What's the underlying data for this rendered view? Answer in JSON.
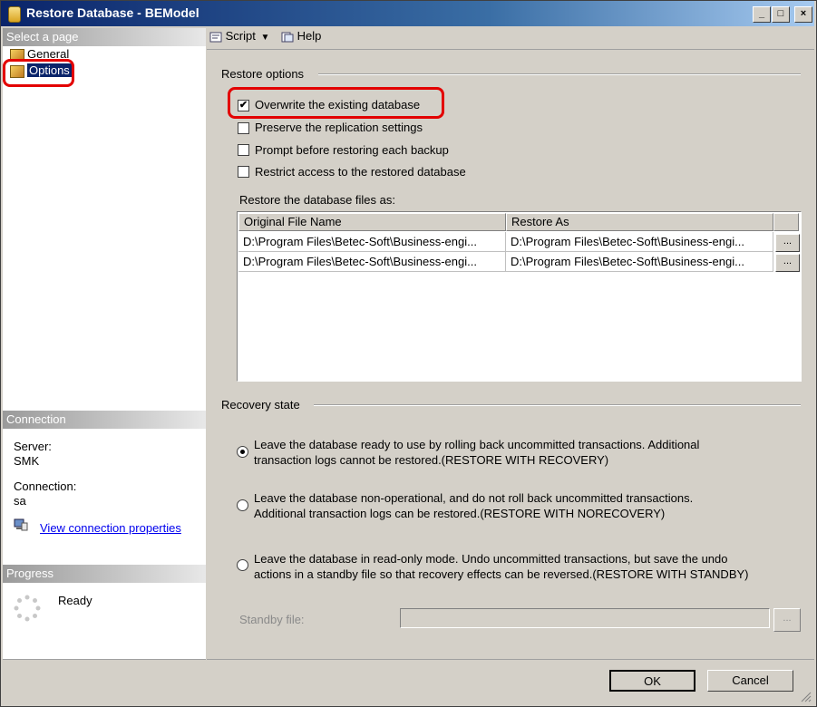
{
  "window": {
    "title": "Restore Database - BEModel",
    "minimize": "_",
    "maximize": "□",
    "close": "×"
  },
  "sidebar": {
    "select_page_header": "Select a page",
    "pages": [
      {
        "label": "General"
      },
      {
        "label": "Options"
      }
    ],
    "connection_header": "Connection",
    "server_label": "Server:",
    "server_value": "SMK",
    "connection_label": "Connection:",
    "connection_value": "sa",
    "view_props_link": "View connection properties",
    "progress_header": "Progress",
    "progress_status": "Ready"
  },
  "toolbar": {
    "script_label": "Script",
    "help_label": "Help"
  },
  "restore_options": {
    "group_label": "Restore options",
    "checkboxes": [
      {
        "label": "Overwrite the existing database",
        "checked": true
      },
      {
        "label": "Preserve the replication settings",
        "checked": false
      },
      {
        "label": "Prompt before restoring each backup",
        "checked": false
      },
      {
        "label": "Restrict access to the restored database",
        "checked": false
      }
    ],
    "files_label": "Restore the database files as:",
    "columns": [
      "Original File Name",
      "Restore As"
    ],
    "rows": [
      {
        "original": "D:\\Program Files\\Betec-Soft\\Business-engi...",
        "restore_as": "D:\\Program Files\\Betec-Soft\\Business-engi...",
        "button": "..."
      },
      {
        "original": "D:\\Program Files\\Betec-Soft\\Business-engi...",
        "restore_as": "D:\\Program Files\\Betec-Soft\\Business-engi...",
        "button": "..."
      }
    ]
  },
  "recovery_state": {
    "group_label": "Recovery state",
    "options": [
      {
        "line1": "Leave the database ready to use by rolling back uncommitted transactions. Additional",
        "line2": "transaction logs cannot be restored.(RESTORE WITH RECOVERY)",
        "selected": true
      },
      {
        "line1": "Leave the database non-operational, and do not roll back uncommitted transactions.",
        "line2": "Additional transaction logs can be restored.(RESTORE WITH NORECOVERY)",
        "selected": false
      },
      {
        "line1": "Leave the database in read-only mode. Undo uncommitted transactions, but save the undo",
        "line2": "actions in a standby file so that recovery effects can be reversed.(RESTORE WITH STANDBY)",
        "selected": false
      }
    ],
    "standby_label": "Standby file:",
    "standby_value": "",
    "standby_button": "..."
  },
  "footer": {
    "ok_label": "OK",
    "cancel_label": "Cancel"
  },
  "colors": {
    "highlight_ring": "#e30000",
    "selection": "#0a246a",
    "title_start": "#0a246a"
  }
}
